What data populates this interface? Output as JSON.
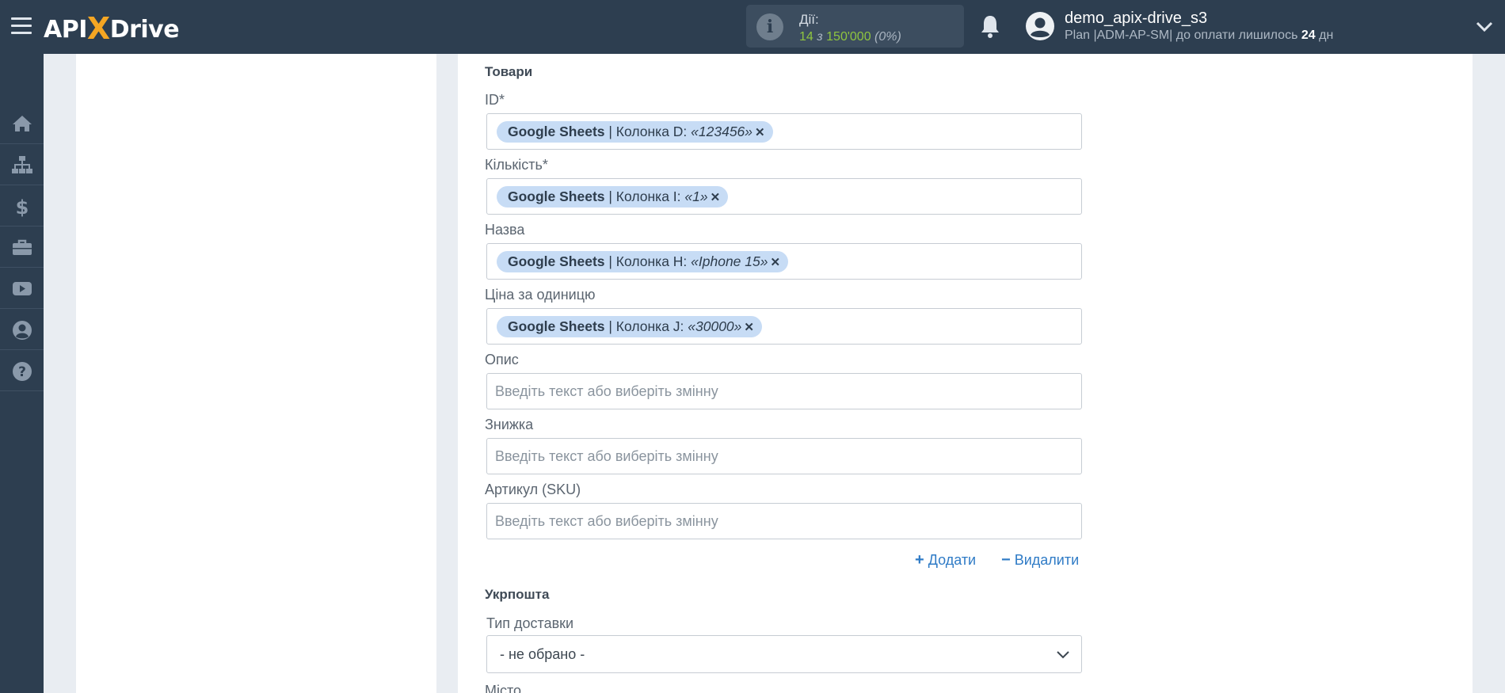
{
  "header": {
    "logo": {
      "api": "API",
      "x": "X",
      "drive": "Drive"
    },
    "actions": {
      "label": "Дії:",
      "count": "14",
      "of": "з",
      "limit": "150'000",
      "percent": "(0%)"
    },
    "user": {
      "name": "demo_apix-drive_s3",
      "plan_prefix": "Plan |ADM-AP-SM| до оплати лишилось",
      "days": "24",
      "days_suffix": "дн"
    }
  },
  "sidebar": {
    "items": [
      {
        "icon": "home-icon"
      },
      {
        "icon": "sitemap-icon"
      },
      {
        "icon": "dollar-icon"
      },
      {
        "icon": "briefcase-icon"
      },
      {
        "icon": "youtube-icon"
      },
      {
        "icon": "user-circle-icon"
      },
      {
        "icon": "question-icon"
      }
    ]
  },
  "form": {
    "goods_section": "Товари",
    "fields": [
      {
        "label": "ID*",
        "chip": {
          "source": "Google Sheets",
          "sep": " | Колонка D: ",
          "value": "«123456»"
        }
      },
      {
        "label": "Кількість*",
        "chip": {
          "source": "Google Sheets",
          "sep": " | Колонка I: ",
          "value": "«1»"
        }
      },
      {
        "label": "Назва",
        "chip": {
          "source": "Google Sheets",
          "sep": " | Колонка H: ",
          "value": "«Iphone 15»"
        }
      },
      {
        "label": "Ціна за одиницю",
        "chip": {
          "source": "Google Sheets",
          "sep": " | Колонка J: ",
          "value": "«30000»"
        }
      },
      {
        "label": "Опис",
        "placeholder": "Введіть текст або виберіть змінну"
      },
      {
        "label": "Знижка",
        "placeholder": "Введіть текст або виберіть змінну"
      },
      {
        "label": "Артикул (SKU)",
        "placeholder": "Введіть текст або виберіть змінну"
      }
    ],
    "add_label": "Додати",
    "remove_label": "Видалити",
    "ukrposhta_section": "Укрпошта",
    "delivery_type_label": "Тип доставки",
    "delivery_type_value": "- не обрано -",
    "city_label": "Місто"
  },
  "colors": {
    "topbar": "#2d3e50",
    "chip": "#c7dcf5",
    "link": "#2f7bc6",
    "actions_count": "#8fc53f",
    "logo_x": "#f5a623"
  }
}
